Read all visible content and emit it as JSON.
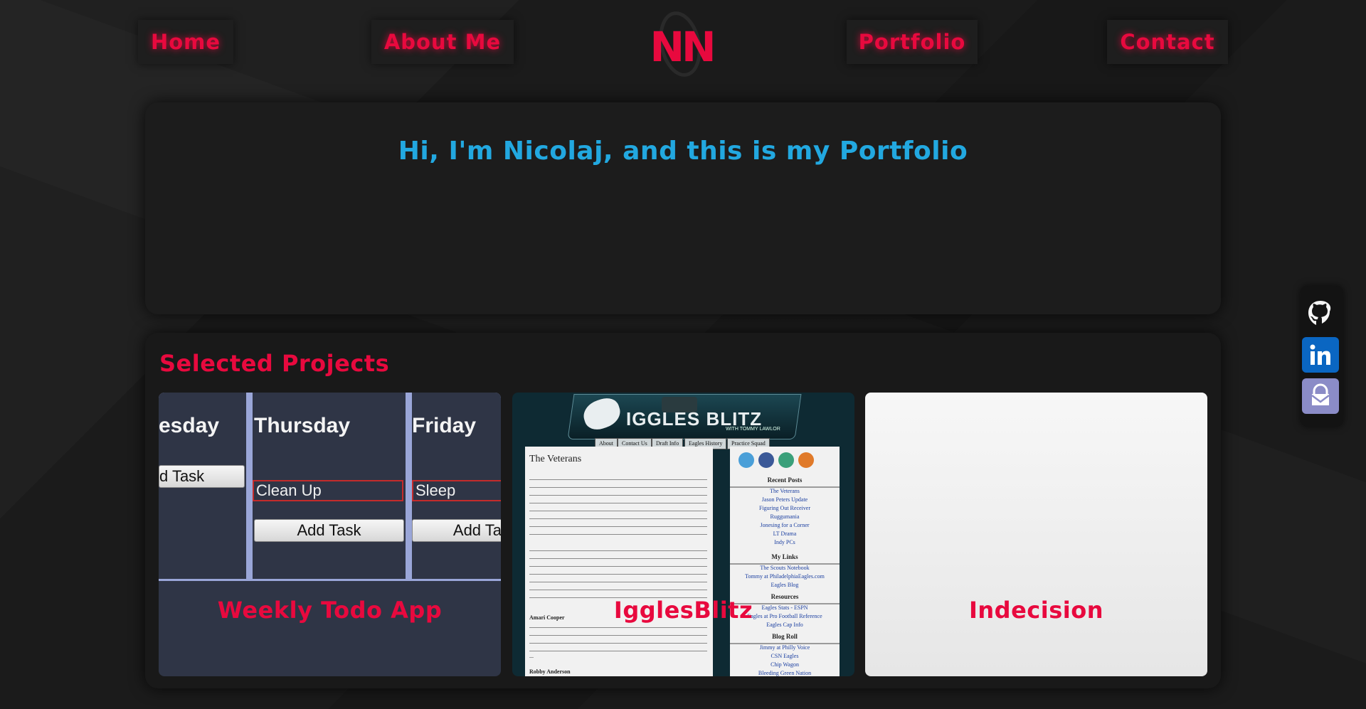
{
  "nav": {
    "home": "Home",
    "about": "About Me",
    "logo": "NN",
    "portfolio": "Portfolio",
    "contact": "Contact"
  },
  "hero": {
    "title": "Hi, I'm Nicolaj, and this is my Portfolio"
  },
  "projects": {
    "title": "Selected Projects",
    "cards": [
      {
        "title": "Weekly Todo App",
        "preview": {
          "days": [
            "esday",
            "Thursday",
            "Friday"
          ],
          "add_label": "Add Task",
          "add_label_partial_left": "d Task",
          "add_label_partial_right": "Add Ta",
          "tasks": [
            "Clean Up",
            "Sleep"
          ]
        }
      },
      {
        "title": "IgglesBlitz",
        "preview": {
          "site_name": "IGGLES BLITZ",
          "site_sub": "WITH TOMMY LAWLOR",
          "tabs": [
            "About",
            "Contact Us",
            "Draft Info",
            "Eagles History",
            "Practice Squad"
          ],
          "post_title": "The Veterans",
          "sections": [
            {
              "heading": "Recent Posts",
              "links": [
                "The Veterans",
                "Jason Peters Update",
                "Figuring Out Receiver",
                "Ruggumania",
                "Jonesing for a Corner",
                "LT Drama",
                "Indy PCs"
              ]
            },
            {
              "heading": "My Links",
              "links": [
                "The Scouts Notebook",
                "Tommy at PhiladelphiaEagles.com",
                "Eagles Blog"
              ]
            },
            {
              "heading": "Resources",
              "links": [
                "Eagles Stats - ESPN",
                "Eagles at Pro Football Reference",
                "Eagles Cap Info"
              ]
            },
            {
              "heading": "Blog Roll",
              "links": [
                "Jimmy at Philly Voice",
                "CSN Eagles",
                "Chip Wagon",
                "Bleeding Green Nation"
              ]
            }
          ],
          "text_blocks": [
            "Amari Cooper",
            "Robby Anderson",
            "..."
          ]
        }
      },
      {
        "title": "Indecision"
      }
    ]
  },
  "social": {
    "icons": [
      "github-icon",
      "linkedin-icon",
      "proton-mail-icon"
    ]
  },
  "colors": {
    "accent_red": "#e8093e",
    "accent_blue": "#22a8e0",
    "background": "#1b1b1b"
  }
}
